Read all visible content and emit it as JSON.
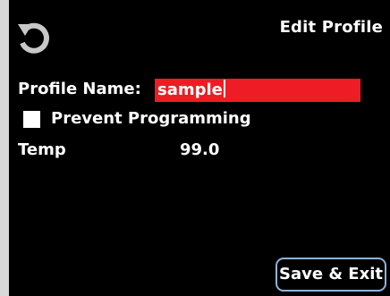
{
  "header": {
    "back_icon": "refresh-back-icon",
    "title": "Edit Profile"
  },
  "form": {
    "profile_name_label": "Profile Name:",
    "profile_name_value": "sample",
    "prevent_programming_label": "Prevent Programming",
    "prevent_programming_checked": false,
    "temp_label": "Temp",
    "temp_value": "99.0"
  },
  "actions": {
    "save_exit_label": "Save & Exit"
  },
  "colors": {
    "background": "#000000",
    "text": "#ffffff",
    "field_highlight": "#ee1c24",
    "button_border": "#8fb3d8",
    "icon": "#c8c8c8"
  }
}
